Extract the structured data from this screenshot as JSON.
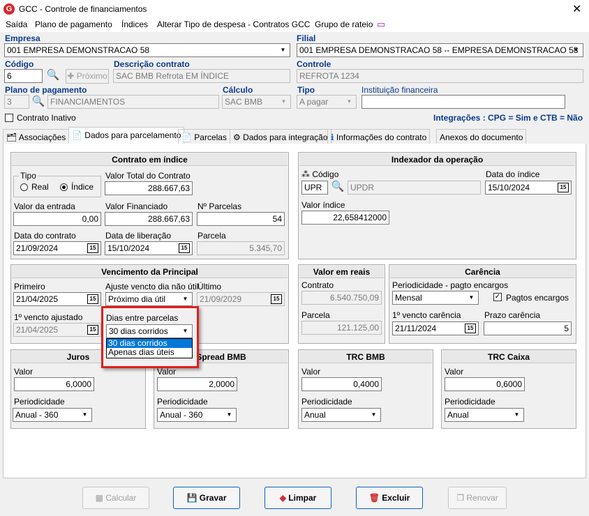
{
  "window": {
    "title": "GCC - Controle de financiamentos"
  },
  "menu": [
    "Saída",
    "Plano de pagamento",
    "Índices",
    "Alterar Tipo de despesa - Contratos GCC",
    "Grupo de rateio"
  ],
  "header": {
    "empresa_label": "Empresa",
    "empresa_value": "001 EMPRESA DEMONSTRACAO 58",
    "filial_label": "Filial",
    "filial_value": "001 EMPRESA DEMONSTRACAO 58 -- EMPRESA DEMONSTRACAO 58",
    "codigo_label": "Código",
    "codigo_value": "6",
    "proximo_label": "Próximo",
    "descricao_label": "Descrição contrato",
    "descricao_value": "SAC BMB Refrota EM ÍNDICE",
    "controle_label": "Controle",
    "controle_value": "REFROTA 1234",
    "plano_label": "Plano de pagamento",
    "plano_code": "3",
    "plano_value": "FINANCIAMENTOS",
    "calculo_label": "Cálculo",
    "calculo_value": "SAC BMB",
    "tipo_label": "Tipo",
    "tipo_value": "A pagar",
    "inst_label": "Instituição financeira",
    "inst_value": "",
    "inativo_label": "Contrato Inativo",
    "integracoes": "Integrações : CPG = Sim e CTB = Não"
  },
  "tabs": [
    "Associações",
    "Dados para parcelamento",
    "Parcelas",
    "Dados para integração",
    "Informações do contrato",
    "Anexos do documento"
  ],
  "contrato": {
    "title": "Contrato em índice",
    "tipo_label": "Tipo",
    "real": "Real",
    "indice": "Índice",
    "valor_total_label": "Valor Total do Contrato",
    "valor_total": "288.667,63",
    "entrada_label": "Valor da entrada",
    "entrada": "0,00",
    "financiado_label": "Valor Financiado",
    "financiado": "288.667,63",
    "nparcelas_label": "Nº Parcelas",
    "nparcelas": "54",
    "data_contrato_label": "Data do contrato",
    "data_contrato": "21/09/2024",
    "data_lib_label": "Data de liberação",
    "data_lib": "15/10/2024",
    "parcela_label": "Parcela",
    "parcela": "5.345,70"
  },
  "indexador": {
    "title": "Indexador da operação",
    "codigo_label": "Código",
    "codigo": "UPR",
    "codigo_desc": "UPDR",
    "data_indice_label": "Data do índice",
    "data_indice": "15/10/2024",
    "valor_indice_label": "Valor índice",
    "valor_indice": "22,658412000"
  },
  "vencimento": {
    "title": "Vencimento da Principal",
    "primeiro_label": "Primeiro",
    "primeiro": "21/04/2025",
    "ajuste_label": "Ajuste vencto dia não útil",
    "ajuste": "Próximo dia útil",
    "ultimo_label": "Último",
    "ultimo": "21/09/2029",
    "ajustado_label": "1º vencto ajustado",
    "ajustado": "21/04/2025",
    "dias_label": "Dias entre parcelas",
    "dias": "30 dias corridos",
    "dias_options": [
      "30 dias corridos",
      "Apenas dias úteis"
    ]
  },
  "valor_reais": {
    "title": "Valor em reais",
    "contrato_label": "Contrato",
    "contrato": "6.540.750,09",
    "parcela_label": "Parcela",
    "parcela": "121.125,00"
  },
  "carencia": {
    "title": "Carência",
    "periodicidade_label": "Periodicidade - pagto encargos",
    "periodicidade": "Mensal",
    "pagtos_label": "Pagtos encargos",
    "venc_label": "1º vencto carência",
    "venc": "21/11/2024",
    "prazo_label": "Prazo carência",
    "prazo": "5"
  },
  "juros": {
    "title": "Juros",
    "valor_label": "Valor",
    "valor": "6,0000",
    "period_label": "Periodicidade",
    "period": "Anual - 360"
  },
  "spread": {
    "title": "Spread BMB",
    "valor_label": "Valor",
    "valor": "2,0000",
    "period_label": "Periodicidade",
    "period": "Anual - 360"
  },
  "trc_bmb": {
    "title": "TRC BMB",
    "valor_label": "Valor",
    "valor": "0,4000",
    "period_label": "Periodicidade",
    "period": "Anual"
  },
  "trc_caixa": {
    "title": "TRC Caixa",
    "valor_label": "Valor",
    "valor": "0,6000",
    "period_label": "Periodicidade",
    "period": "Anual"
  },
  "buttons": {
    "calcular": "Calcular",
    "gravar": "Gravar",
    "limpar": "Limpar",
    "excluir": "Excluir",
    "renovar": "Renovar"
  },
  "colors": {
    "accent": "#0b62c0",
    "highlight": "#e0201c",
    "selection": "#0078d7",
    "icon_purple": "#b44bd2"
  }
}
